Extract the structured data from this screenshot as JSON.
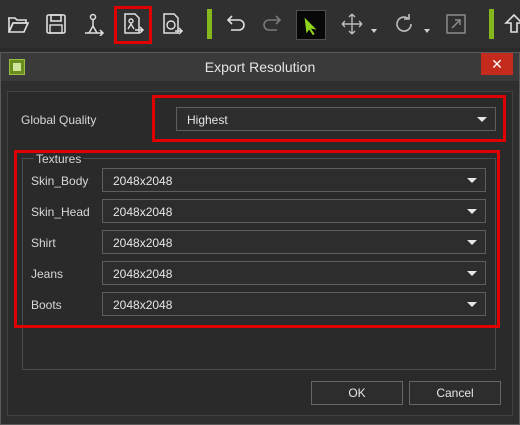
{
  "toolbar": {
    "tools": [
      {
        "name": "open-icon"
      },
      {
        "name": "save-icon"
      },
      {
        "name": "export-fbx-icon"
      },
      {
        "name": "export-character-icon"
      },
      {
        "name": "export-object-icon"
      },
      {
        "name": "undo-icon"
      },
      {
        "name": "redo-icon"
      },
      {
        "name": "select-tool-icon"
      },
      {
        "name": "move-tool-icon"
      },
      {
        "name": "rotate-tool-icon"
      },
      {
        "name": "scale-tool-icon"
      },
      {
        "name": "upload-icon"
      }
    ],
    "accent_color": "#84b81e",
    "highlight_color": "#e00000"
  },
  "dialog": {
    "title": "Export Resolution",
    "close_symbol": "✕",
    "global_quality": {
      "label": "Global Quality",
      "value": "Highest"
    },
    "textures": {
      "label": "Textures",
      "rows": [
        {
          "label": "Skin_Body",
          "value": "2048x2048"
        },
        {
          "label": "Skin_Head",
          "value": "2048x2048"
        },
        {
          "label": "Shirt",
          "value": "2048x2048"
        },
        {
          "label": "Jeans",
          "value": "2048x2048"
        },
        {
          "label": "Boots",
          "value": "2048x2048"
        }
      ]
    },
    "ok_label": "OK",
    "cancel_label": "Cancel"
  }
}
